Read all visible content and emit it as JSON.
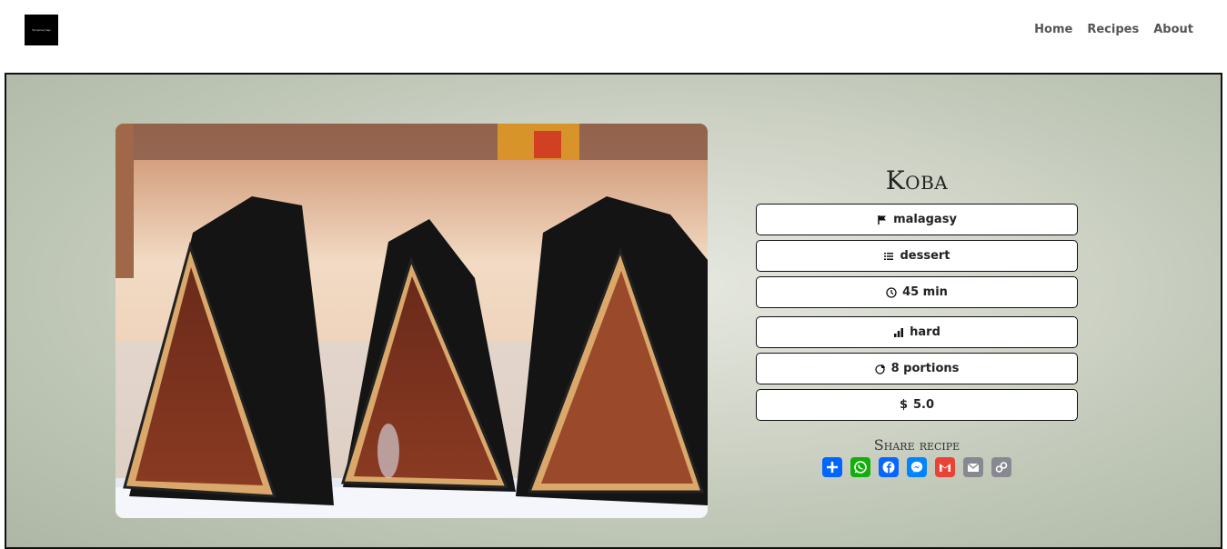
{
  "header": {
    "logo_text": "Temporary logo",
    "nav": [
      {
        "label": "Home"
      },
      {
        "label": "Recipes"
      },
      {
        "label": "About"
      }
    ]
  },
  "recipe": {
    "title": "Koba",
    "image_alt": "Koba",
    "details": {
      "cuisine": "malagasy",
      "category": "dessert",
      "time": "45 min",
      "difficulty": "hard",
      "portions": "8 portions",
      "price": "5.0"
    }
  },
  "share": {
    "title": "Share recipe",
    "buttons": [
      {
        "icon": "share-add-icon",
        "color": "#0166ff"
      },
      {
        "icon": "whatsapp-icon",
        "color": "#12af0a"
      },
      {
        "icon": "facebook-icon",
        "color": "#0866ff"
      },
      {
        "icon": "messenger-icon",
        "color": "#0084ff"
      },
      {
        "icon": "gmail-icon",
        "color": "#ea4335"
      },
      {
        "icon": "email-icon",
        "color": "#888990"
      },
      {
        "icon": "copy-link-icon",
        "color": "#888990"
      }
    ]
  }
}
